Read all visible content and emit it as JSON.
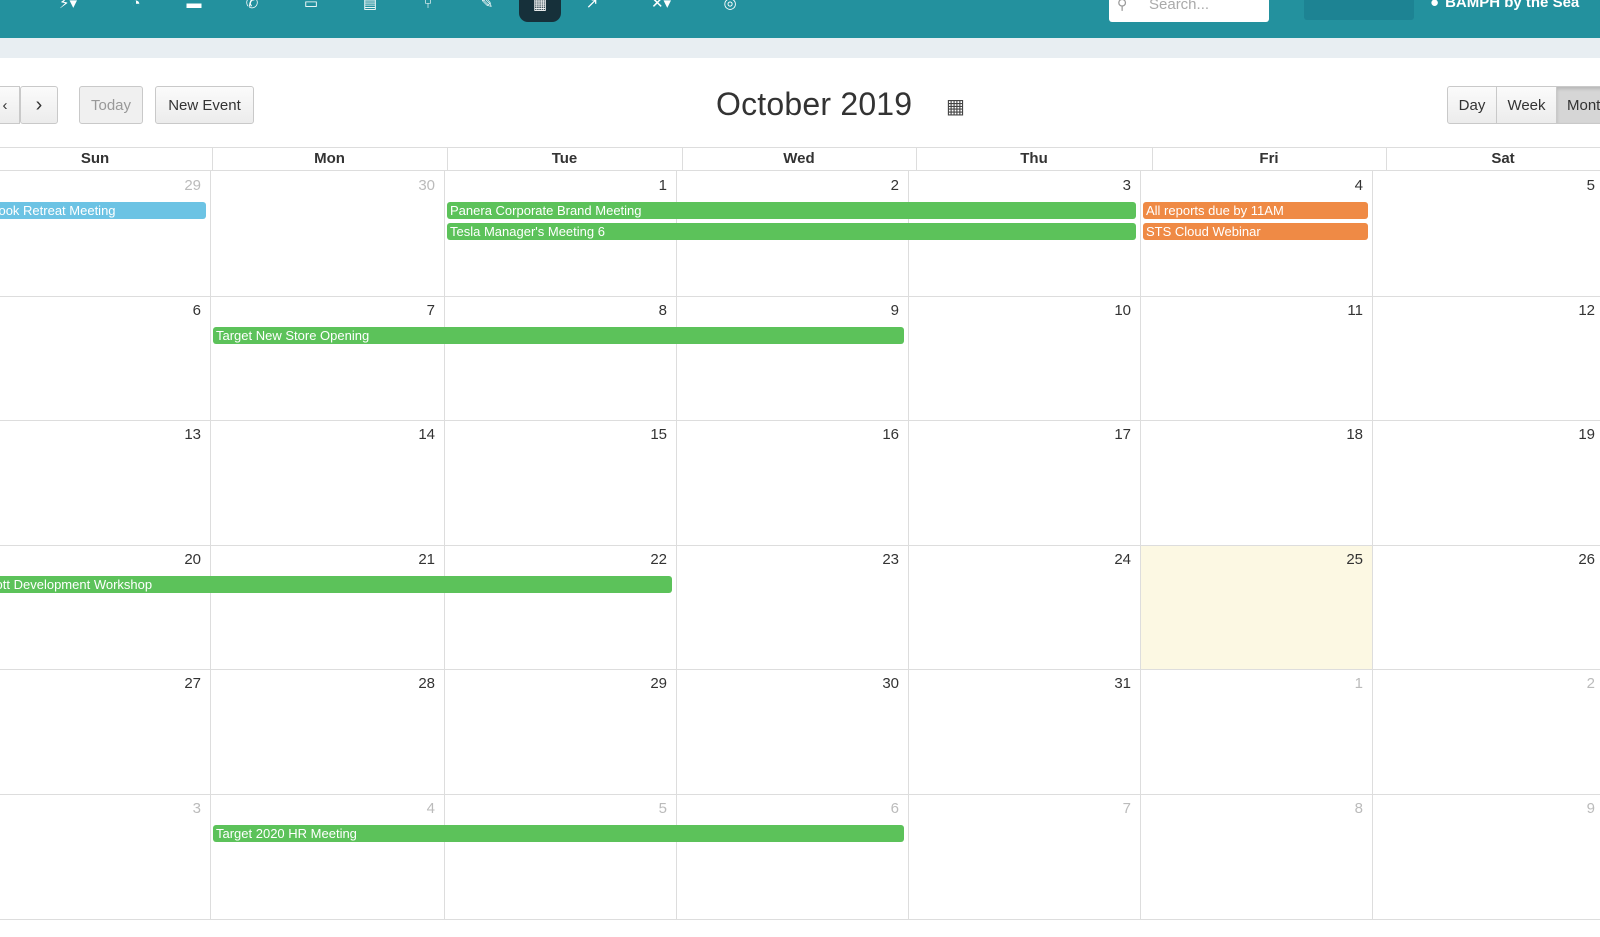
{
  "topbar": {
    "icons": [
      "bolt-dropdown-icon",
      "clock-icon",
      "square-icon",
      "phone-icon",
      "inbox-icon",
      "building-icon",
      "cutlery-icon",
      "pencil-icon",
      "calendar-grid-icon",
      "chart-icon",
      "tools-dropdown-icon",
      "globe-icon"
    ],
    "search_placeholder": "Search...",
    "user_name": "BAMPH by the Sea",
    "accent": "#23919e"
  },
  "toolbar": {
    "prev": "‹",
    "next": "›",
    "today": "Today",
    "new_event": "New Event",
    "title": "October 2019",
    "views": [
      "Day",
      "Week",
      "Month"
    ],
    "active_view": "Month"
  },
  "weekdays": [
    "Sun",
    "Mon",
    "Tue",
    "Wed",
    "Thu",
    "Fri",
    "Sat"
  ],
  "weeks": [
    [
      {
        "d": "29",
        "other": true
      },
      {
        "d": "30",
        "other": true
      },
      {
        "d": "1"
      },
      {
        "d": "2"
      },
      {
        "d": "3"
      },
      {
        "d": "4"
      },
      {
        "d": "5"
      }
    ],
    [
      {
        "d": "6"
      },
      {
        "d": "7"
      },
      {
        "d": "8"
      },
      {
        "d": "9"
      },
      {
        "d": "10"
      },
      {
        "d": "11"
      },
      {
        "d": "12"
      }
    ],
    [
      {
        "d": "13"
      },
      {
        "d": "14"
      },
      {
        "d": "15"
      },
      {
        "d": "16"
      },
      {
        "d": "17"
      },
      {
        "d": "18"
      },
      {
        "d": "19"
      }
    ],
    [
      {
        "d": "20"
      },
      {
        "d": "21"
      },
      {
        "d": "22"
      },
      {
        "d": "23"
      },
      {
        "d": "24"
      },
      {
        "d": "25",
        "today": true
      },
      {
        "d": "26"
      }
    ],
    [
      {
        "d": "27"
      },
      {
        "d": "28"
      },
      {
        "d": "29"
      },
      {
        "d": "30"
      },
      {
        "d": "31"
      },
      {
        "d": "1",
        "other": true
      },
      {
        "d": "2",
        "other": true
      }
    ],
    [
      {
        "d": "3",
        "other": true
      },
      {
        "d": "4",
        "other": true
      },
      {
        "d": "5",
        "other": true
      },
      {
        "d": "6",
        "other": true
      },
      {
        "d": "7",
        "other": true
      },
      {
        "d": "8",
        "other": true
      },
      {
        "d": "9",
        "other": true
      }
    ]
  ],
  "events": [
    {
      "title": "ebook Retreat Meeting",
      "week": 0,
      "start": 0,
      "end": 0,
      "slot": 0,
      "color": "#6cc3e4"
    },
    {
      "title": "Panera Corporate Brand Meeting",
      "week": 0,
      "start": 2,
      "end": 4,
      "slot": 0,
      "color": "#5cc25a"
    },
    {
      "title": "Tesla Manager's Meeting 6",
      "week": 0,
      "start": 2,
      "end": 4,
      "slot": 1,
      "color": "#5cc25a"
    },
    {
      "title": "All reports due by 11AM",
      "week": 0,
      "start": 5,
      "end": 5,
      "slot": 0,
      "color": "#ef8a45"
    },
    {
      "title": "STS Cloud Webinar",
      "week": 0,
      "start": 5,
      "end": 5,
      "slot": 1,
      "color": "#ef8a45"
    },
    {
      "title": "Target New Store Opening",
      "week": 1,
      "start": 1,
      "end": 3,
      "slot": 0,
      "color": "#5cc25a"
    },
    {
      "title": "rriott Development Workshop",
      "week": 3,
      "start": 0,
      "end": 2,
      "slot": 0,
      "color": "#5cc25a"
    },
    {
      "title": "Target 2020 HR Meeting",
      "week": 5,
      "start": 1,
      "end": 3,
      "slot": 0,
      "color": "#5cc25a"
    }
  ],
  "colors": {
    "today_bg": "#fcf8e3",
    "green": "#5cc25a",
    "orange": "#ef8a45",
    "blue": "#6cc3e4"
  }
}
